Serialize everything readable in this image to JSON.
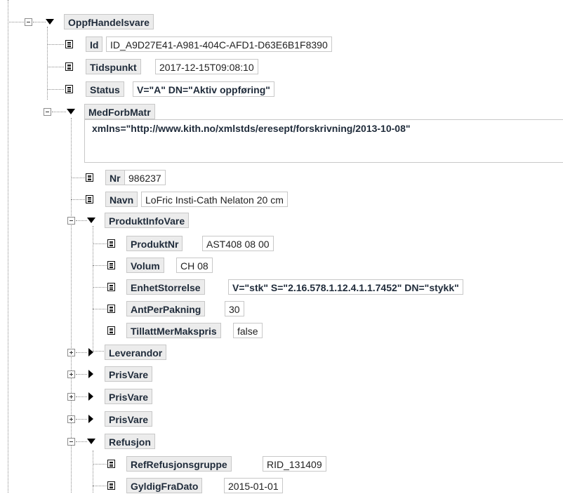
{
  "tree": {
    "root": {
      "name": "OppfHandelsvare"
    },
    "id": {
      "name": "Id",
      "value": "ID_A9D27E41-A981-404C-AFD1-D63E6B1F8390"
    },
    "tidspunkt": {
      "name": "Tidspunkt",
      "value": "2017-12-15T09:08:10"
    },
    "status": {
      "name": "Status",
      "value": "V=\"A\" DN=\"Aktiv oppføring\""
    },
    "medforbmatr": {
      "name": "MedForbMatr",
      "xmlns": "xmlns=\"http://www.kith.no/xmlstds/eresept/forskrivning/2013-10-08\""
    },
    "nr": {
      "name": "Nr",
      "value": "986237"
    },
    "navn": {
      "name": "Navn",
      "value": "LoFric Insti-Cath Nelaton 20 cm"
    },
    "produktinfovare": {
      "name": "ProduktInfoVare"
    },
    "produktnr": {
      "name": "ProduktNr",
      "value": "AST408 08 00"
    },
    "volum": {
      "name": "Volum",
      "value": "CH 08"
    },
    "enhetstorrelse": {
      "name": "EnhetStorrelse",
      "value": "V=\"stk\" S=\"2.16.578.1.12.4.1.1.7452\" DN=\"stykk\""
    },
    "antperpakning": {
      "name": "AntPerPakning",
      "value": "30"
    },
    "tillattmermakspris": {
      "name": "TillattMerMakspris",
      "value": "false"
    },
    "leverandor": {
      "name": "Leverandor"
    },
    "prisvare1": {
      "name": "PrisVare"
    },
    "prisvare2": {
      "name": "PrisVare"
    },
    "prisvare3": {
      "name": "PrisVare"
    },
    "refusjon": {
      "name": "Refusjon"
    },
    "refrefusjonsgruppe": {
      "name": "RefRefusjonsgruppe",
      "value": "RID_131409"
    },
    "gyldigfradato": {
      "name": "GyldigFraDato",
      "value": "2015-01-01"
    }
  }
}
